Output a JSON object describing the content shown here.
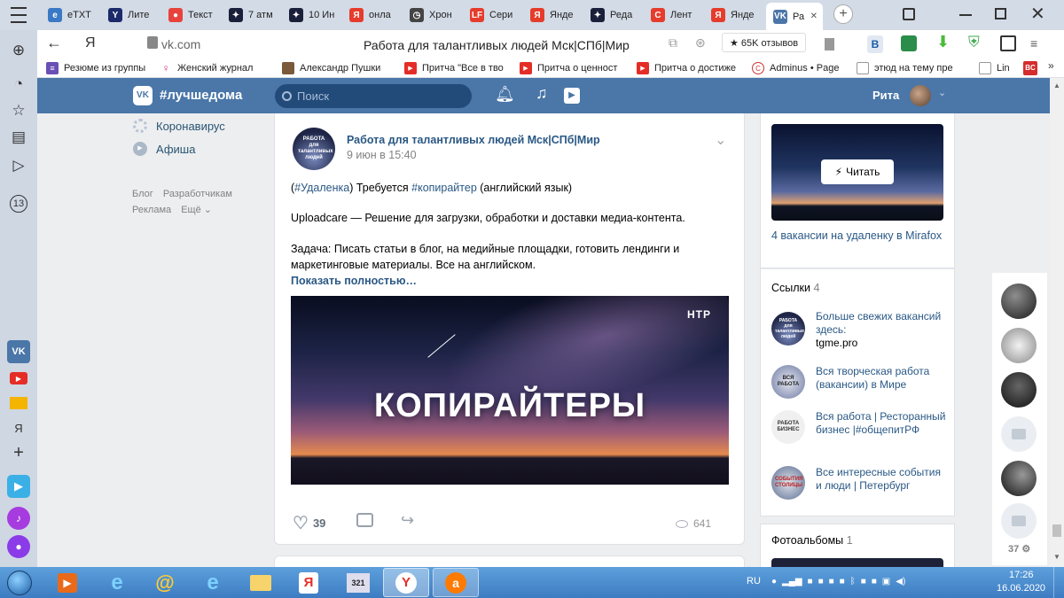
{
  "browser": {
    "tabs": [
      {
        "label": "eTXT",
        "icon": "etxt-icon",
        "color": "#3a79c6"
      },
      {
        "label": "Лите",
        "icon": "y-icon",
        "color": "#1c2a6b"
      },
      {
        "label": "Текст",
        "icon": "red-circle-icon",
        "color": "#e8423c"
      },
      {
        "label": "7 атм",
        "icon": "star-icon",
        "color": "#1a1f3a"
      },
      {
        "label": "10 Ин",
        "icon": "star-icon",
        "color": "#1a1f3a"
      },
      {
        "label": "онла",
        "icon": "yandex-icon",
        "color": "#e53c2c"
      },
      {
        "label": "Хрон",
        "icon": "clock-icon",
        "color": "#444"
      },
      {
        "label": "Сери",
        "icon": "lf-icon",
        "color": "#e53c2c"
      },
      {
        "label": "Янде",
        "icon": "yandex-icon",
        "color": "#e53c2c"
      },
      {
        "label": "Реда",
        "icon": "star-icon",
        "color": "#1a1f3a"
      },
      {
        "label": "Лент",
        "icon": "c-icon",
        "color": "#e53c2c"
      },
      {
        "label": "Янде",
        "icon": "yandex-icon",
        "color": "#e53c2c"
      },
      {
        "label": "Ра",
        "icon": "vk-icon",
        "color": "#4a76a8"
      }
    ],
    "url": "vk.com",
    "page_title": "Работа для талантливых людей Мск|СПб|Мир",
    "reviews": "★ 65K отзывов",
    "ext_badge": "В",
    "bookmarks": [
      "Резюме из группы",
      "Женский журнал",
      "Александр Пушки",
      "Притча \"Все в тво",
      "Притча о ценност",
      "Притча о достиже",
      "Adminus • Page",
      "этюд на тему пре",
      "Lin"
    ]
  },
  "vk": {
    "brand": "#лучшедома",
    "search_placeholder": "Поиск",
    "user_name": "Рита",
    "left_menu": [
      {
        "label": "Коронавирус",
        "icon": "virus-icon"
      },
      {
        "label": "Афиша",
        "icon": "play-icon"
      }
    ],
    "footer_links": [
      "Блог",
      "Разработчикам",
      "Реклама",
      "Ещё"
    ],
    "post": {
      "author": "Работа для талантливых людей Мск|СПб|Мир",
      "date": "9 июн в 15:40",
      "line1_a": "(",
      "line1_tag1": "#Удаленка",
      "line1_b": ") Требуется ",
      "line1_tag2": "#копирайтер",
      "line1_c": " (английский язык)",
      "line2": "Uploadcare — Решение для загрузки, обработки и доставки медиа-контента.",
      "line3": "Задача: Писать статьи в блог, на медийные площадки, готовить лендинги и маркетинговые материалы. Все на английском.",
      "show_more": "Показать полностью…",
      "image_text": "КОПИРАЙТЕРЫ",
      "image_logo": "НТР",
      "avatar_text": "РАБОТА для талантливых людей",
      "likes": "39",
      "views": "641"
    },
    "right": {
      "read_button": "Читать",
      "article_title": "4 вакансии на удаленку в Mirafox",
      "links_title": "Ссылки",
      "links_count": "4",
      "links": [
        {
          "title": "Больше свежих вакансий здесь:",
          "sub": "tgme.pro",
          "thumb": "РАБОТА для талантливых людей"
        },
        {
          "title": "Вся творческая работа (вакансии) в Мире",
          "sub": "",
          "thumb": "ВСЯ РАБОТА"
        },
        {
          "title": "Вся работа | Ресторанный бизнес |#общепитРФ",
          "sub": "",
          "thumb": "РАБОТА БИЗНЕС"
        },
        {
          "title": "Все интересные события и люди | Петербург",
          "sub": "",
          "thumb": "СОБЫТИЯ СТОЛИЦЫ"
        }
      ],
      "albums_title": "Фотоальбомы",
      "albums_count": "1"
    },
    "friends_count": "37"
  },
  "system": {
    "lang": "RU",
    "time": "17:26",
    "date": "16.06.2020"
  }
}
